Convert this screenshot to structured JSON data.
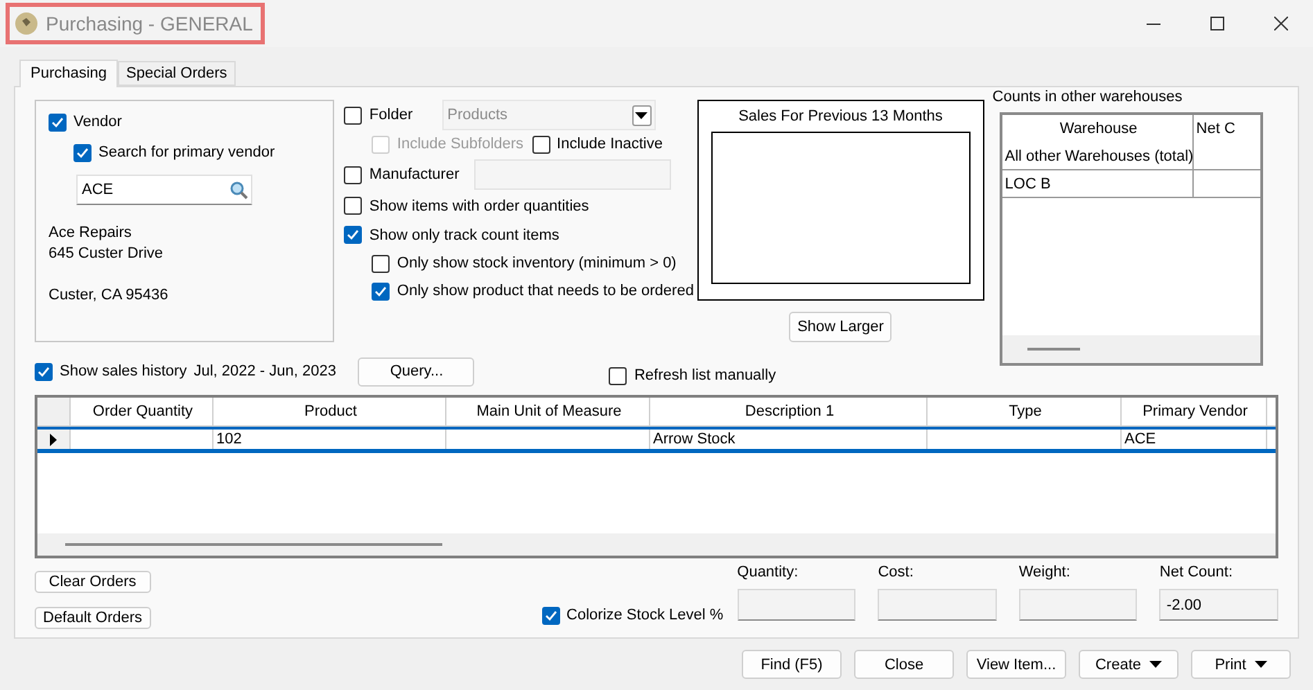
{
  "window": {
    "title": "Purchasing - GENERAL"
  },
  "tabs": [
    {
      "label": "Purchasing",
      "selected": true
    },
    {
      "label": "Special Orders",
      "selected": false
    }
  ],
  "vendor_filter": {
    "label": "Vendor",
    "checked": true,
    "search_primary": {
      "label": "Search for primary vendor",
      "checked": true
    },
    "vendor_code": "ACE",
    "address": [
      "Ace Repairs",
      "645 Custer Drive"
    ],
    "city_line": "Custer, CA 95436"
  },
  "folder": {
    "label": "Folder",
    "checked": false,
    "value": "Products",
    "include_subfolders": {
      "label": "Include Subfolders",
      "checked": false,
      "disabled": true
    },
    "include_inactive": {
      "label": "Include Inactive",
      "checked": false
    }
  },
  "manufacturer": {
    "label": "Manufacturer",
    "checked": false
  },
  "options": [
    {
      "label": "Show items with order quantities",
      "checked": false
    },
    {
      "label": "Show only track count items",
      "checked": true,
      "children": [
        {
          "label": "Only show stock inventory (minimum > 0)",
          "checked": false
        },
        {
          "label": "Only show product that needs to be ordered",
          "checked": true
        }
      ]
    }
  ],
  "sales_chart": {
    "title": "Sales For Previous 13 Months",
    "button": "Show Larger"
  },
  "warehouses": {
    "label": "Counts in other warehouses",
    "columns": [
      "Warehouse",
      "Net C"
    ],
    "rows": [
      {
        "warehouse": "All other Warehouses (total)"
      },
      {
        "warehouse": "LOC B"
      }
    ]
  },
  "sales_history": {
    "label": "Show sales history",
    "checked": true,
    "period": "Jul, 2022 - Jun, 2023"
  },
  "query_button": "Query...",
  "refresh_manually": {
    "label": "Refresh list manually",
    "checked": false
  },
  "grid": {
    "columns": [
      "Order Quantity",
      "Product",
      "Main Unit of Measure",
      "Description 1",
      "Type",
      "Primary Vendor"
    ],
    "rows": [
      {
        "selected": true,
        "cells": [
          null,
          "102",
          null,
          "Arrow Stock",
          null,
          "ACE"
        ]
      }
    ]
  },
  "order_buttons": [
    "Clear Orders",
    "Default Orders"
  ],
  "colorize": {
    "label": "Colorize Stock Level %",
    "checked": true
  },
  "totals": [
    {
      "label": "Quantity:"
    },
    {
      "label": "Cost:"
    },
    {
      "label": "Weight:"
    },
    {
      "label": "Net Count:",
      "value": "-2.00"
    }
  ],
  "footer_buttons": [
    {
      "label": "Find (F5)",
      "kind": "button"
    },
    {
      "label": "Close",
      "kind": "button"
    },
    {
      "label": "View Item...",
      "kind": "button"
    },
    {
      "label": "Create",
      "kind": "menu"
    },
    {
      "label": "Print",
      "kind": "menu"
    }
  ]
}
